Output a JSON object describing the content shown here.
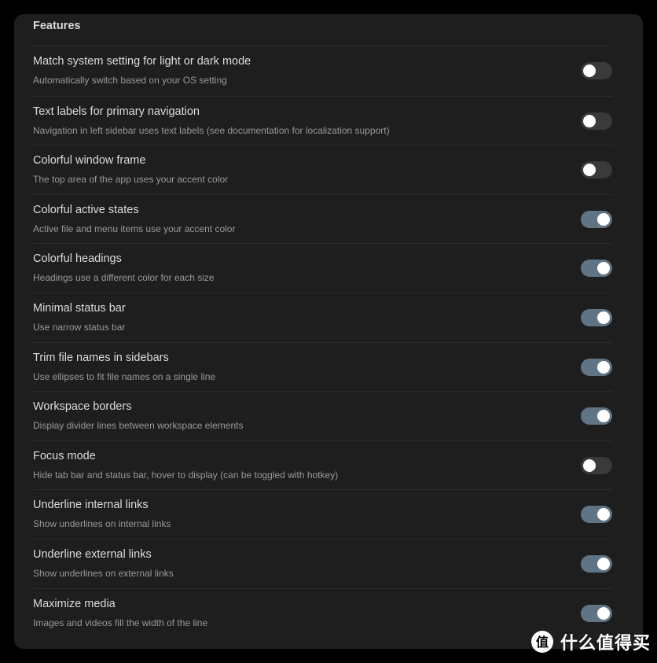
{
  "section": {
    "title": "Features"
  },
  "settings": [
    {
      "name": "Match system setting for light or dark mode",
      "description": "Automatically switch based on your OS setting",
      "enabled": false
    },
    {
      "name": "Text labels for primary navigation",
      "description": "Navigation in left sidebar uses text labels (see documentation for localization support)",
      "enabled": false
    },
    {
      "name": "Colorful window frame",
      "description": "The top area of the app uses your accent color",
      "enabled": false
    },
    {
      "name": "Colorful active states",
      "description": "Active file and menu items use your accent color",
      "enabled": true
    },
    {
      "name": "Colorful headings",
      "description": "Headings use a different color for each size",
      "enabled": true
    },
    {
      "name": "Minimal status bar",
      "description": "Use narrow status bar",
      "enabled": true
    },
    {
      "name": "Trim file names in sidebars",
      "description": "Use ellipses to fit file names on a single line",
      "enabled": true
    },
    {
      "name": "Workspace borders",
      "description": "Display divider lines between workspace elements",
      "enabled": true
    },
    {
      "name": "Focus mode",
      "description": "Hide tab bar and status bar, hover to display (can be toggled with hotkey)",
      "enabled": false
    },
    {
      "name": "Underline internal links",
      "description": "Show underlines on internal links",
      "enabled": true
    },
    {
      "name": "Underline external links",
      "description": "Show underlines on external links",
      "enabled": true
    },
    {
      "name": "Maximize media",
      "description": "Images and videos fill the width of the line",
      "enabled": true
    }
  ],
  "watermark": {
    "text": "什么值得买",
    "icon": "zhi-logo-icon"
  },
  "colors": {
    "background": "#000000",
    "panel": "#1e1e1e",
    "toggle_on": "#5f7485",
    "toggle_off": "#3a3a3a"
  }
}
